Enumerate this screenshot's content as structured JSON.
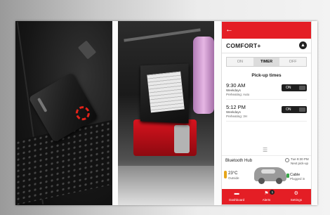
{
  "app": {
    "back_icon": "arrow-left-icon",
    "title": "COMFORT+",
    "tabs": [
      {
        "label": "ON",
        "active": false
      },
      {
        "label": "TIMER",
        "active": true
      },
      {
        "label": "OFF",
        "active": false
      }
    ],
    "section_title": "Pick-up times",
    "pickups": [
      {
        "time": "9:30 AM",
        "days": "Weekdays",
        "detail": "Preheating: Auto",
        "toggle": "ON"
      },
      {
        "time": "5:12 PM",
        "days": "Weekdays",
        "detail": "Preheating: 3H",
        "toggle": "ON"
      }
    ],
    "hub": {
      "name": "Bluetooth Hub",
      "temperature": "23°C",
      "temperature_label": "Outside",
      "next_pickup": "Tue 9:30 PM",
      "next_pickup_label": "Next pick-up",
      "cable": "Cable",
      "cable_status": "Plugged in"
    },
    "nav": [
      {
        "label": "Dashboard",
        "icon": "car-icon"
      },
      {
        "label": "Alerts",
        "icon": "alert-icon",
        "badge": "1"
      },
      {
        "label": "Settings",
        "icon": "gear-icon"
      }
    ],
    "colors": {
      "brand_red": "#e41e25"
    }
  }
}
